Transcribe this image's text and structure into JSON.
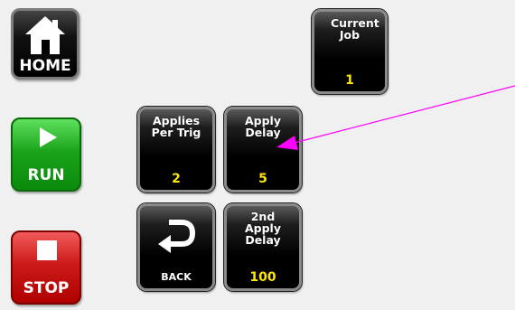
{
  "home": {
    "label": "HOME"
  },
  "run": {
    "label": "RUN"
  },
  "stop": {
    "label": "STOP"
  },
  "current_job": {
    "title": "Current Job",
    "value": "1"
  },
  "applies_per_trig": {
    "title": "Applies Per Trig",
    "value": "2"
  },
  "apply_delay": {
    "title": "Apply Delay",
    "value": "5"
  },
  "back": {
    "label": "BACK"
  },
  "second_apply_delay": {
    "title": "2nd Apply Delay",
    "value": "100"
  },
  "colors": {
    "value_text": "#ffe600",
    "run_green": "#1ba41b",
    "stop_red": "#cc1a1a",
    "annotation_arrow": "#ff00ff"
  }
}
